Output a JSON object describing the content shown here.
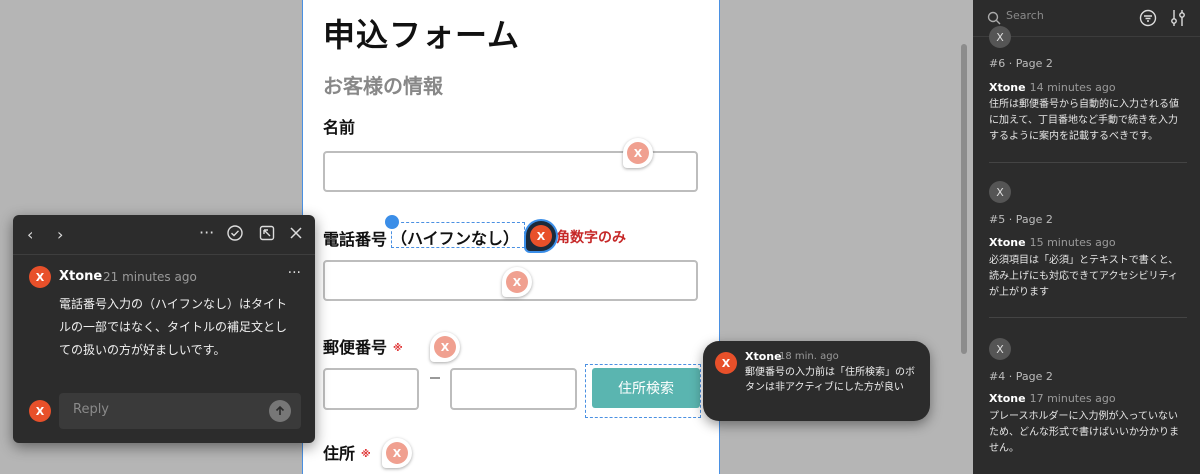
{
  "form": {
    "title": "申込フォーム",
    "section": "お客様の情報",
    "name_label": "名前",
    "phone_label": "電話番号",
    "phone_sub": "（ハイフンなし）",
    "phone_hint": "角数字のみ",
    "zip_label": "郵便番号",
    "required_mark": "※",
    "address_search": "住所検索",
    "address_label": "住所"
  },
  "pin_initial": "X",
  "thread": {
    "author": "Xtone",
    "time": "21 minutes ago",
    "body": "電話番号入力の（ハイフンなし）はタイトルの一部ではなく、タイトルの補足文としての扱いの方が好ましいです。",
    "reply_placeholder": "Reply",
    "more": "···"
  },
  "tooltip": {
    "author": "Xtone",
    "time": "18 min. ago",
    "body": "郵便番号の入力前は「住所検索」のボタンは非アクティブにした方が良い"
  },
  "panel": {
    "search_placeholder": "Search",
    "items": [
      {
        "page": "#6 · Page 2",
        "author": "Xtone",
        "time": "14 minutes ago",
        "body": "住所は郵便番号から自動的に入力される値に加えて、丁目番地など手動で続きを入力するように案内を記載するべきです。"
      },
      {
        "page": "#5 · Page 2",
        "author": "Xtone",
        "time": "15 minutes ago",
        "body": "必須項目は「必須」とテキストで書くと、読み上げにも対応できてアクセシビリティが上がります"
      },
      {
        "page": "#4 · Page 2",
        "author": "Xtone",
        "time": "17 minutes ago",
        "body": "プレースホルダーに入力例が入っていないため、どんな形式で書けばいいか分かりません。"
      }
    ]
  },
  "colors": {
    "accent": "#4a90e2",
    "avatar": "#e8502a",
    "button": "#5ab5b0",
    "required": "#e03a3a"
  }
}
